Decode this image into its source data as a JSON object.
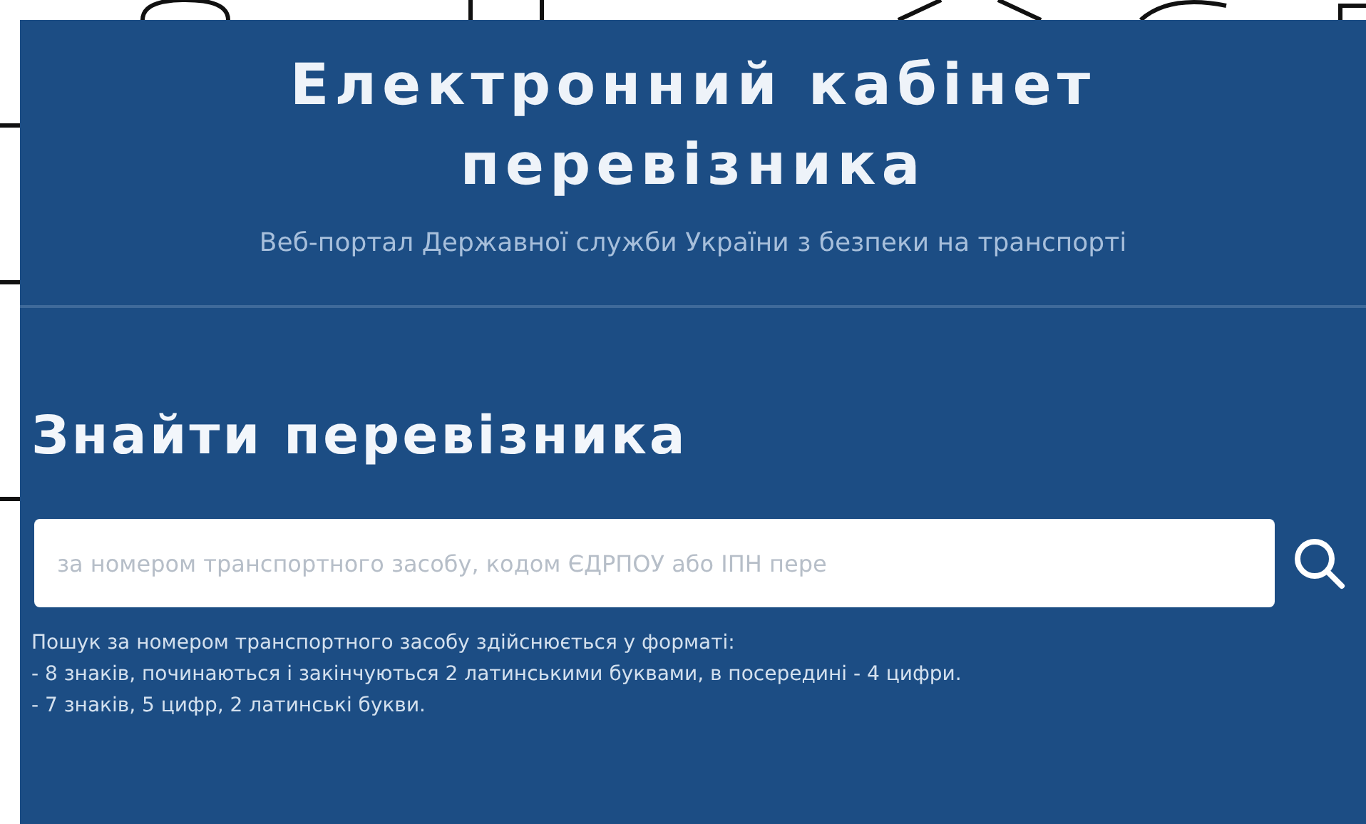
{
  "header": {
    "title": "Електронний кабінет перевізника",
    "subtitle": "Веб-портал Державної служби України з безпеки на транспорті"
  },
  "search": {
    "heading": "Знайти перевізника",
    "placeholder": "за номером транспортного засобу, кодом ЄДРПОУ або ІПН пере",
    "help": [
      "Пошук за номером транспортного засобу здійснюється у форматі:",
      "- 8 знаків, починаються і закінчуються 2 латинськими буквами, в посередині - 4 цифри.",
      "- 7 знаків, 5 цифр, 2 латинські букви."
    ]
  }
}
